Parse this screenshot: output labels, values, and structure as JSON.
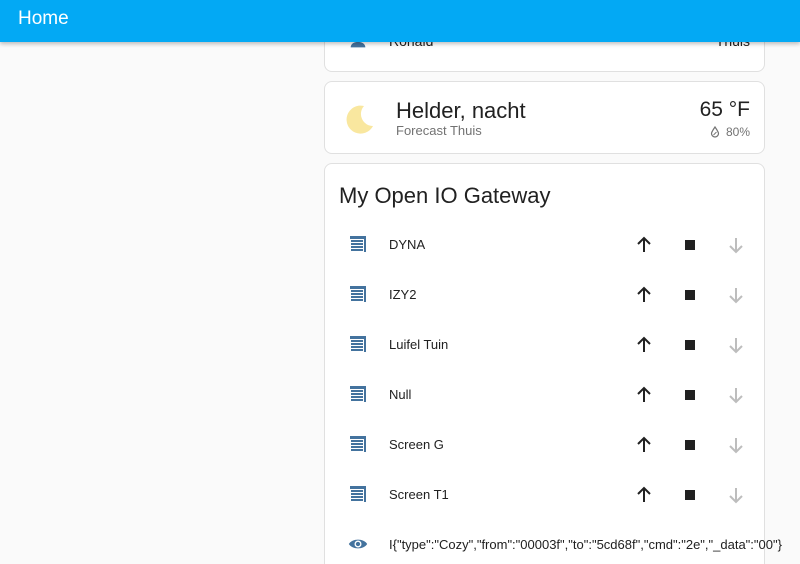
{
  "header": {
    "title": "Home"
  },
  "person": {
    "name": "Ronald",
    "state": "Thuis"
  },
  "weather": {
    "condition": "Helder, nacht",
    "subtitle": "Forecast Thuis",
    "temperature": "65 °F",
    "humidity": "80%"
  },
  "gateway": {
    "title": "My Open IO Gateway",
    "covers": [
      {
        "name": "DYNA"
      },
      {
        "name": "IZY2"
      },
      {
        "name": "Luifel Tuin"
      },
      {
        "name": "Null"
      },
      {
        "name": "Screen G"
      },
      {
        "name": "Screen T1"
      }
    ],
    "sensor": {
      "state": "I{\"type\":\"Cozy\",\"from\":\"00003f\",\"to\":\"5cd68f\",\"cmd\":\"2e\",\"_data\":\"00\"}"
    }
  },
  "colors": {
    "header": "#03a9f4",
    "icon_blue": "#44739e",
    "moon": "#f9e79f"
  }
}
